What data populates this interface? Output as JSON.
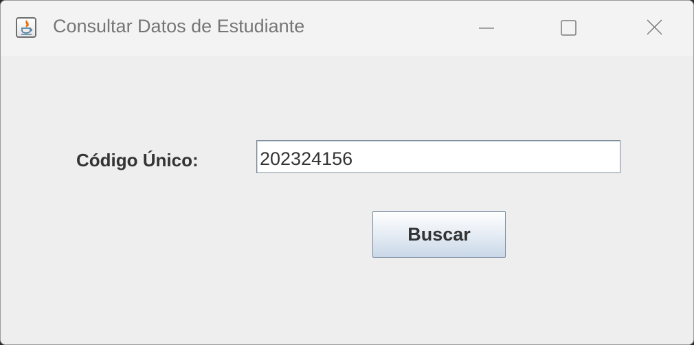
{
  "window": {
    "title": "Consultar Datos de Estudiante",
    "icon": "java-cup-icon",
    "controls": [
      "minimize",
      "maximize",
      "close"
    ]
  },
  "form": {
    "code_label": "Código Único:",
    "code_value": "202324156",
    "search_button_label": "Buscar"
  },
  "colors": {
    "background": "#eeeeee",
    "titlebar": "#f3f3f3",
    "text": "#333333",
    "title_text": "#757575",
    "java_orange": "#e76f00",
    "java_blue": "#5382a1"
  }
}
